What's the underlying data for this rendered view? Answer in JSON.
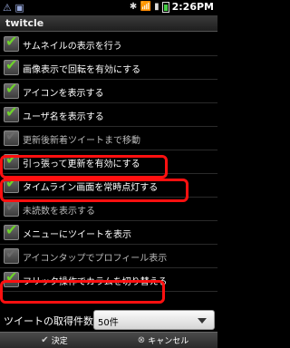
{
  "status": {
    "left_icons": "⚠ ▣",
    "right_icons": "✱ 📶 ▮",
    "time": "2:26PM"
  },
  "title": "twitcle",
  "options": [
    {
      "label": "サムネイルの表示を行う",
      "checked": true,
      "enabled": true
    },
    {
      "label": "画像表示で回転を有効にする",
      "checked": true,
      "enabled": true
    },
    {
      "label": "アイコンを表示する",
      "checked": true,
      "enabled": true
    },
    {
      "label": "ユーザ名を表示する",
      "checked": true,
      "enabled": true
    },
    {
      "label": "更新後新着ツイートまで移動",
      "checked": true,
      "enabled": false
    },
    {
      "label": "引っ張って更新を有効にする",
      "checked": true,
      "enabled": true
    },
    {
      "label": "タイムライン画面を常時点灯する",
      "checked": true,
      "enabled": true
    },
    {
      "label": "未読数を表示する",
      "checked": true,
      "enabled": false
    },
    {
      "label": "メニューにツイートを表示",
      "checked": true,
      "enabled": true
    },
    {
      "label": "アイコンタップでプロフィール表示",
      "checked": true,
      "enabled": false
    },
    {
      "label": "フリック操作でカラムを切り替える",
      "checked": true,
      "enabled": true
    }
  ],
  "fetch": {
    "label": "ツイートの取得件数",
    "value": "50件"
  },
  "buttons": {
    "ok": "決定",
    "cancel": "キャンセル"
  },
  "colors": {
    "highlight": "#ff1010",
    "check": "#6ed32a"
  }
}
